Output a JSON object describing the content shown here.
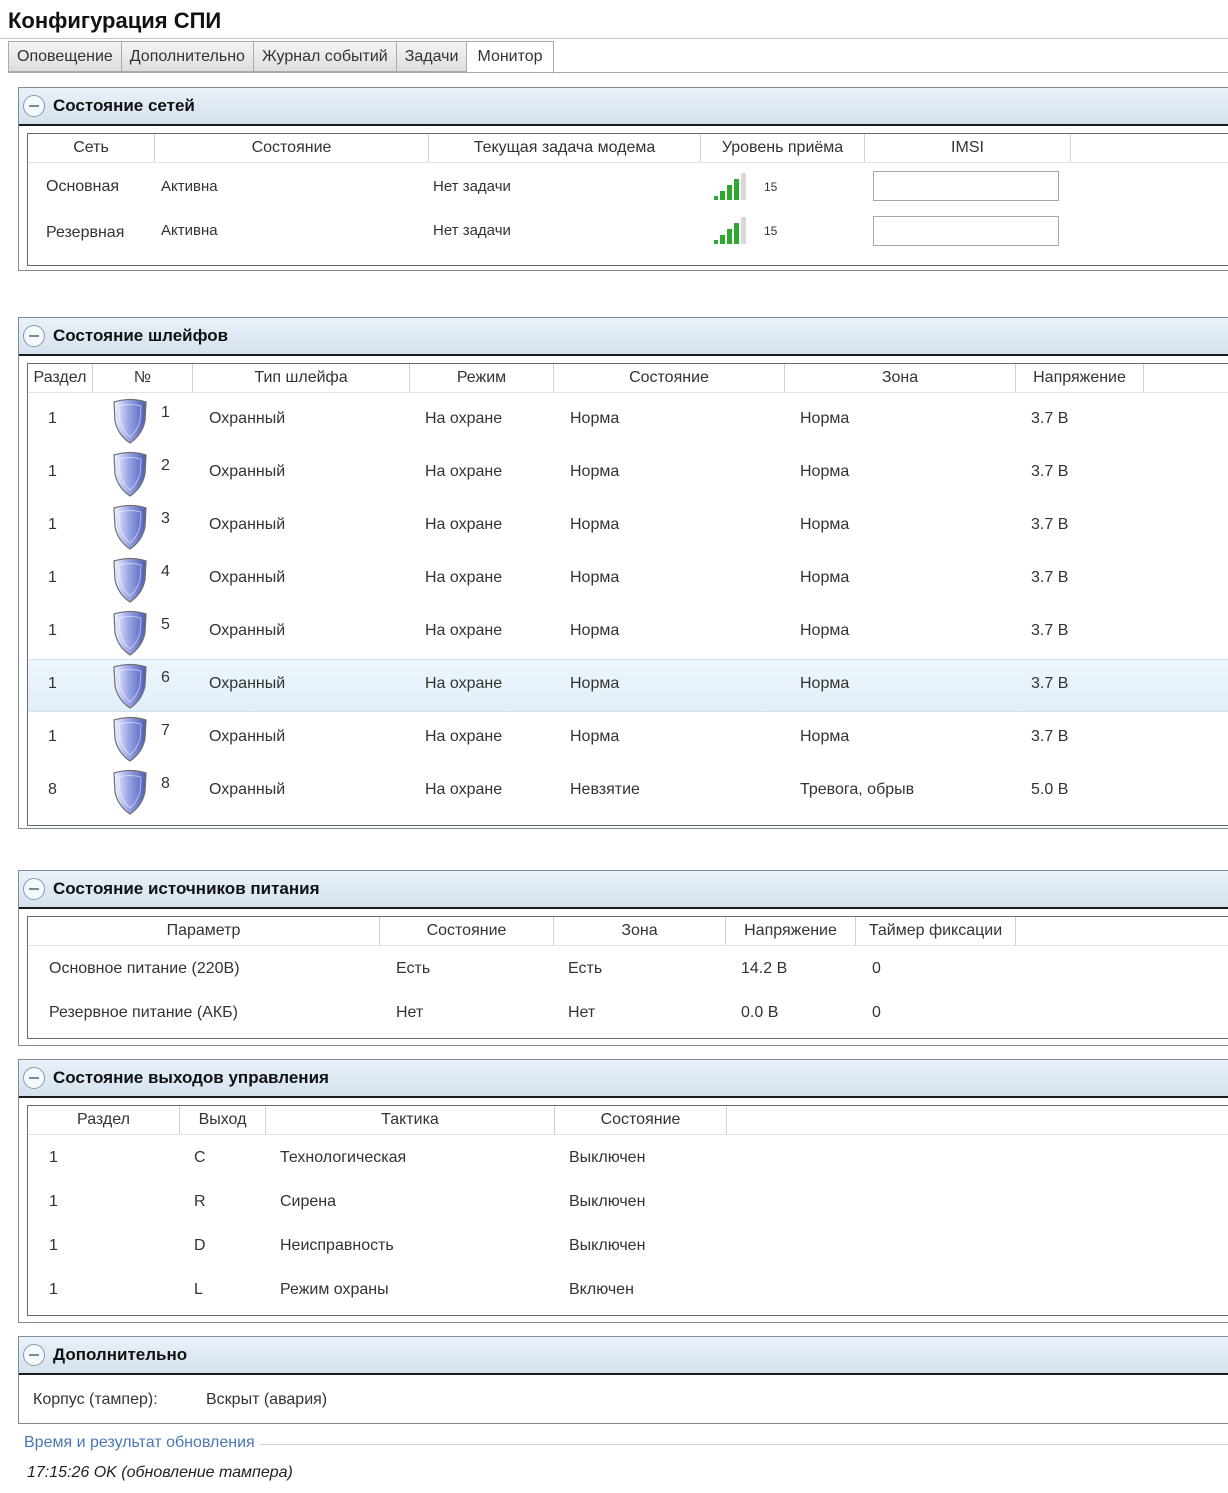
{
  "window": {
    "title": "Конфигурация СПИ"
  },
  "tabs": [
    "Оповещение",
    "Дополнительно",
    "Журнал событий",
    "Задачи",
    "Монитор"
  ],
  "networks": {
    "title": "Состояние сетей",
    "columns": [
      "Сеть",
      "Состояние",
      "Текущая задача модема",
      "Уровень приёма",
      "IMSI"
    ],
    "rows": [
      {
        "net": "Основная",
        "state": "Активна",
        "task": "Нет задачи",
        "signal": "15",
        "imsi": ""
      },
      {
        "net": "Резервная",
        "state": "Активна",
        "task": "Нет задачи",
        "signal": "15",
        "imsi": ""
      }
    ]
  },
  "loops": {
    "title": "Состояние шлейфов",
    "columns": [
      "Раздел",
      "№",
      "Тип шлейфа",
      "Режим",
      "Состояние",
      "Зона",
      "Напряжение"
    ],
    "rows": [
      {
        "section": "1",
        "num": "1",
        "type": "Охранный",
        "mode": "На охране",
        "state": "Норма",
        "zone": "Норма",
        "voltage": "3.7 В"
      },
      {
        "section": "1",
        "num": "2",
        "type": "Охранный",
        "mode": "На охране",
        "state": "Норма",
        "zone": "Норма",
        "voltage": "3.7 В"
      },
      {
        "section": "1",
        "num": "3",
        "type": "Охранный",
        "mode": "На охране",
        "state": "Норма",
        "zone": "Норма",
        "voltage": "3.7 В"
      },
      {
        "section": "1",
        "num": "4",
        "type": "Охранный",
        "mode": "На охране",
        "state": "Норма",
        "zone": "Норма",
        "voltage": "3.7 В"
      },
      {
        "section": "1",
        "num": "5",
        "type": "Охранный",
        "mode": "На охране",
        "state": "Норма",
        "zone": "Норма",
        "voltage": "3.7 В"
      },
      {
        "section": "1",
        "num": "6",
        "type": "Охранный",
        "mode": "На охране",
        "state": "Норма",
        "zone": "Норма",
        "voltage": "3.7 В"
      },
      {
        "section": "1",
        "num": "7",
        "type": "Охранный",
        "mode": "На охране",
        "state": "Норма",
        "zone": "Норма",
        "voltage": "3.7 В"
      },
      {
        "section": "8",
        "num": "8",
        "type": "Охранный",
        "mode": "На охране",
        "state": "Невзятие",
        "zone": "Тревога, обрыв",
        "voltage": "5.0 В"
      }
    ],
    "selected_row": "6"
  },
  "power": {
    "title": "Состояние источников питания",
    "columns": [
      "Параметр",
      "Состояние",
      "Зона",
      "Напряжение",
      "Таймер фиксации"
    ],
    "rows": [
      {
        "param": "Основное питание (220В)",
        "state": "Есть",
        "zone": "Есть",
        "voltage": "14.2 В",
        "timer": "0"
      },
      {
        "param": "Резервное питание (АКБ)",
        "state": "Нет",
        "zone": "Нет",
        "voltage": "0.0 В",
        "timer": "0"
      }
    ]
  },
  "outputs": {
    "title": "Состояние выходов управления",
    "columns": [
      "Раздел",
      "Выход",
      "Тактика",
      "Состояние"
    ],
    "rows": [
      {
        "section": "1",
        "output": "C",
        "tactic": "Технологическая",
        "state": "Выключен"
      },
      {
        "section": "1",
        "output": "R",
        "tactic": "Сирена",
        "state": "Выключен"
      },
      {
        "section": "1",
        "output": "D",
        "tactic": "Неисправность",
        "state": "Выключен"
      },
      {
        "section": "1",
        "output": "L",
        "tactic": "Режим охраны",
        "state": "Включен"
      }
    ]
  },
  "extra": {
    "title": "Дополнительно",
    "tamper_label": "Корпус (тампер):",
    "tamper_value": "Вскрыт (авария)"
  },
  "update": {
    "legend": "Время и результат обновления",
    "text": "17:15:26 OK (обновление тампера)"
  },
  "colors": {
    "accent": "#4a78b4",
    "signal": "#2fa82f",
    "header": "#d4e2ee",
    "shield": "#6a78c8"
  }
}
